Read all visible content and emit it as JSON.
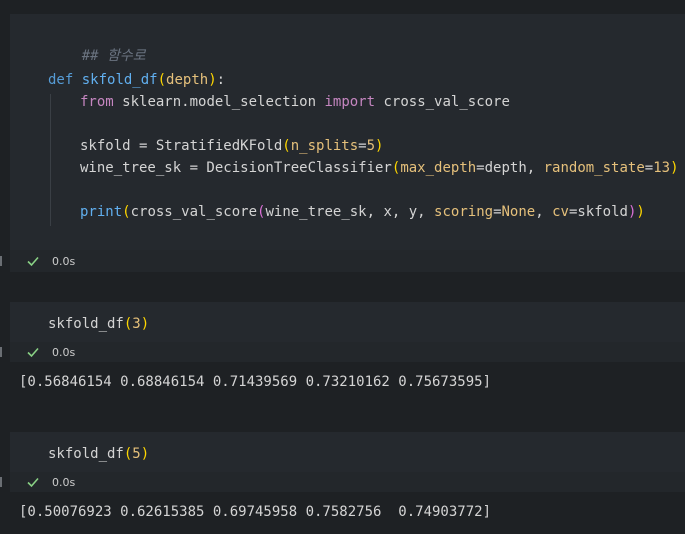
{
  "cells": [
    {
      "code": {
        "comment": "## 함수로",
        "def_kw": "def",
        "func_name": "skfold_df",
        "def_open": "(",
        "def_param": "depth",
        "def_close": ")",
        "def_colon": ":",
        "from_kw": "from",
        "module": "sklearn.model_selection",
        "import_kw": "import",
        "imported": "cross_val_score",
        "skfold_lhs": "skfold = StratifiedKFold",
        "skfold_open": "(",
        "skfold_param": "n_splits",
        "skfold_eq": "=",
        "skfold_val": "5",
        "skfold_close": ")",
        "tree_lhs": "wine_tree_sk = DecisionTreeClassifier",
        "tree_open": "(",
        "tree_p1": "max_depth",
        "tree_eq1": "=depth, ",
        "tree_p2": "random_state",
        "tree_eq2": "=",
        "tree_val": "13",
        "tree_close": ")",
        "print_fn": "print",
        "print_open": "(",
        "cvs_fn": "cross_val_score",
        "cvs_open": "(",
        "cvs_args": "wine_tree_sk, x, y, ",
        "cvs_p1": "scoring",
        "cvs_eq1": "=",
        "cvs_none": "None",
        "cvs_sep": ", ",
        "cvs_p2": "cv",
        "cvs_eq2": "=skfold",
        "cvs_close": ")",
        "print_close": ")"
      },
      "status_time": "0.0s"
    },
    {
      "code": {
        "call": "skfold_df",
        "open": "(",
        "arg": "3",
        "close": ")"
      },
      "status_time": "0.0s",
      "output": "[0.56846154 0.68846154 0.71439569 0.73210162 0.75673595]"
    },
    {
      "code": {
        "call": "skfold_df",
        "open": "(",
        "arg": "5",
        "close": ")"
      },
      "status_time": "0.0s",
      "output": "[0.50076923 0.62615385 0.69745958 0.7582756  0.74903772]"
    }
  ],
  "colors": {
    "background": "#1e2124",
    "cell_bg": "#25292e",
    "success": "#89d185"
  },
  "icons": {
    "status": "check-icon"
  }
}
